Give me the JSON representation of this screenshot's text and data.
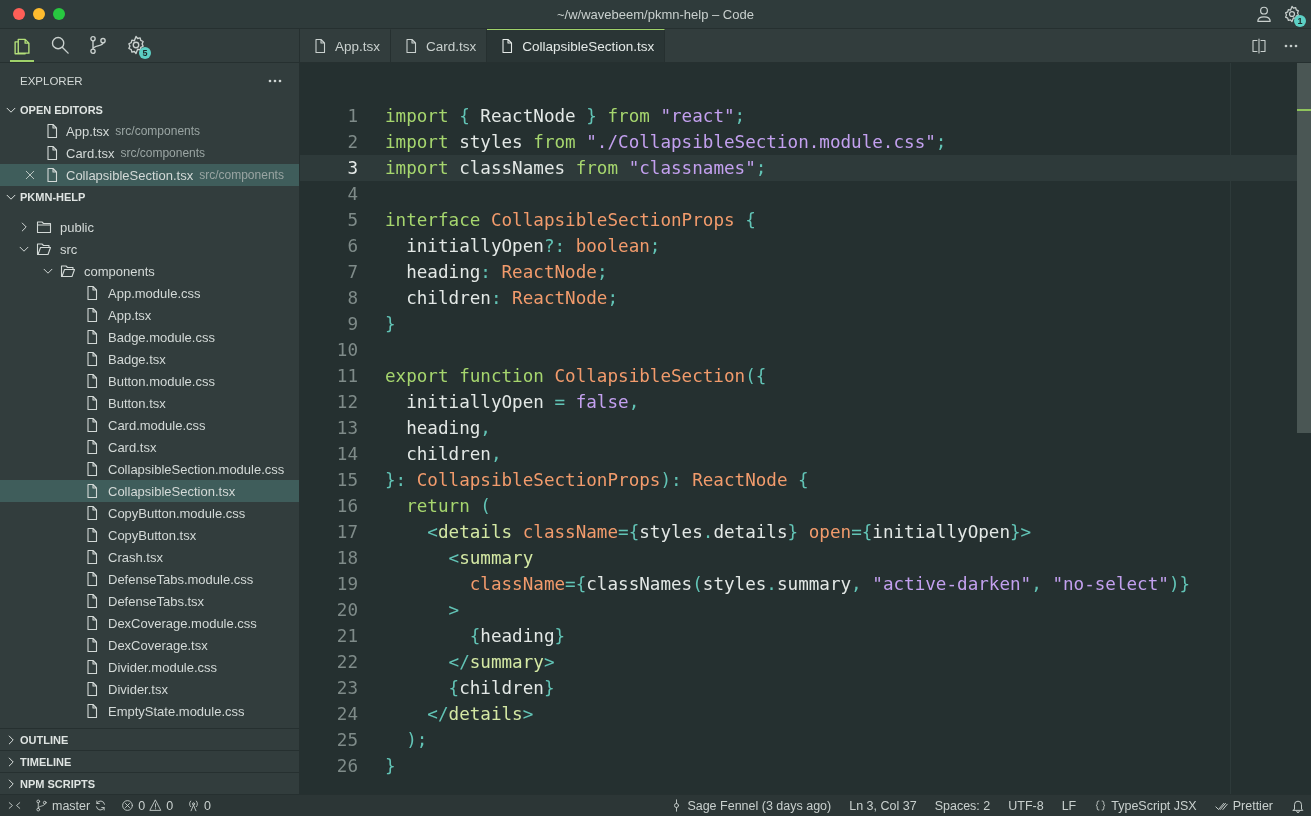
{
  "window": {
    "title": "~/w/wavebeem/pkmn-help – Code"
  },
  "activity_bar": {
    "extensions_badge": "5"
  },
  "account": {
    "settings_badge": "1"
  },
  "explorer": {
    "title": "EXPLORER",
    "open_editors": {
      "title": "OPEN EDITORS",
      "expanded": true,
      "items": [
        {
          "name": "App.tsx",
          "path": "src/components",
          "selected": false
        },
        {
          "name": "Card.tsx",
          "path": "src/components",
          "selected": false
        },
        {
          "name": "CollapsibleSection.tsx",
          "path": "src/components",
          "selected": true
        }
      ]
    },
    "project": {
      "title": "PKMN-HELP",
      "expanded": true,
      "tree": [
        {
          "kind": "folder",
          "name": "public",
          "expanded": false
        },
        {
          "kind": "folder",
          "name": "src",
          "expanded": true,
          "children": [
            {
              "kind": "folder",
              "name": "components",
              "expanded": true,
              "children": [
                {
                  "kind": "file",
                  "name": "App.module.css",
                  "selected": false
                },
                {
                  "kind": "file",
                  "name": "App.tsx",
                  "selected": false
                },
                {
                  "kind": "file",
                  "name": "Badge.module.css",
                  "selected": false
                },
                {
                  "kind": "file",
                  "name": "Badge.tsx",
                  "selected": false
                },
                {
                  "kind": "file",
                  "name": "Button.module.css",
                  "selected": false
                },
                {
                  "kind": "file",
                  "name": "Button.tsx",
                  "selected": false
                },
                {
                  "kind": "file",
                  "name": "Card.module.css",
                  "selected": false
                },
                {
                  "kind": "file",
                  "name": "Card.tsx",
                  "selected": false
                },
                {
                  "kind": "file",
                  "name": "CollapsibleSection.module.css",
                  "selected": false
                },
                {
                  "kind": "file",
                  "name": "CollapsibleSection.tsx",
                  "selected": true
                },
                {
                  "kind": "file",
                  "name": "CopyButton.module.css",
                  "selected": false
                },
                {
                  "kind": "file",
                  "name": "CopyButton.tsx",
                  "selected": false
                },
                {
                  "kind": "file",
                  "name": "Crash.tsx",
                  "selected": false
                },
                {
                  "kind": "file",
                  "name": "DefenseTabs.module.css",
                  "selected": false
                },
                {
                  "kind": "file",
                  "name": "DefenseTabs.tsx",
                  "selected": false
                },
                {
                  "kind": "file",
                  "name": "DexCoverage.module.css",
                  "selected": false
                },
                {
                  "kind": "file",
                  "name": "DexCoverage.tsx",
                  "selected": false
                },
                {
                  "kind": "file",
                  "name": "Divider.module.css",
                  "selected": false
                },
                {
                  "kind": "file",
                  "name": "Divider.tsx",
                  "selected": false
                },
                {
                  "kind": "file",
                  "name": "EmptyState.module.css",
                  "selected": false
                }
              ]
            }
          ]
        }
      ]
    },
    "sections": [
      {
        "title": "OUTLINE",
        "expanded": false
      },
      {
        "title": "TIMELINE",
        "expanded": false
      },
      {
        "title": "NPM SCRIPTS",
        "expanded": false
      }
    ]
  },
  "tabs": [
    {
      "label": "App.tsx",
      "selected": false
    },
    {
      "label": "Card.tsx",
      "selected": false
    },
    {
      "label": "CollapsibleSection.tsx",
      "selected": true
    }
  ],
  "editor": {
    "lines": [
      {
        "number": "1",
        "selected": false,
        "tokens": [
          {
            "kind": "kw",
            "text": "import"
          },
          {
            "kind": "p",
            "text": " { "
          },
          {
            "kind": "id",
            "text": "ReactNode"
          },
          {
            "kind": "p",
            "text": " } "
          },
          {
            "kind": "kw",
            "text": "from"
          },
          {
            "kind": "str",
            "text": " \"react\""
          },
          {
            "kind": "p",
            "text": ";"
          }
        ]
      },
      {
        "number": "2",
        "selected": false,
        "tokens": [
          {
            "kind": "kw",
            "text": "import"
          },
          {
            "kind": "id",
            "text": " styles "
          },
          {
            "kind": "kw",
            "text": "from"
          },
          {
            "kind": "str",
            "text": " \"./CollapsibleSection.module.css\""
          },
          {
            "kind": "p",
            "text": ";"
          }
        ]
      },
      {
        "number": "3",
        "selected": true,
        "tokens": [
          {
            "kind": "kw",
            "text": "import"
          },
          {
            "kind": "id",
            "text": " classNames "
          },
          {
            "kind": "kw",
            "text": "from"
          },
          {
            "kind": "str",
            "text": " \"classnames\""
          },
          {
            "kind": "p",
            "text": ";"
          }
        ]
      },
      {
        "number": "4",
        "selected": false
      },
      {
        "number": "5",
        "selected": false,
        "tokens": [
          {
            "kind": "kw",
            "text": "interface"
          },
          {
            "kind": "ty",
            "text": " CollapsibleSectionProps"
          },
          {
            "kind": "p",
            "text": " {"
          }
        ]
      },
      {
        "number": "6",
        "selected": false,
        "tokens": [
          {
            "kind": "id",
            "text": "  initiallyOpen"
          },
          {
            "kind": "p",
            "text": "?:"
          },
          {
            "kind": "ty",
            "text": " boolean"
          },
          {
            "kind": "p",
            "text": ";"
          }
        ]
      },
      {
        "number": "7",
        "selected": false,
        "tokens": [
          {
            "kind": "id",
            "text": "  heading"
          },
          {
            "kind": "p",
            "text": ":"
          },
          {
            "kind": "ty",
            "text": " ReactNode"
          },
          {
            "kind": "p",
            "text": ";"
          }
        ]
      },
      {
        "number": "8",
        "selected": false,
        "tokens": [
          {
            "kind": "id",
            "text": "  children"
          },
          {
            "kind": "p",
            "text": ":"
          },
          {
            "kind": "ty",
            "text": " ReactNode"
          },
          {
            "kind": "p",
            "text": ";"
          }
        ]
      },
      {
        "number": "9",
        "selected": false,
        "tokens": [
          {
            "kind": "p",
            "text": "}"
          }
        ]
      },
      {
        "number": "10",
        "selected": false
      },
      {
        "number": "11",
        "selected": false,
        "tokens": [
          {
            "kind": "kw",
            "text": "export function"
          },
          {
            "kind": "ty",
            "text": " CollapsibleSection"
          },
          {
            "kind": "p",
            "text": "({"
          }
        ]
      },
      {
        "number": "12",
        "selected": false,
        "tokens": [
          {
            "kind": "id",
            "text": "  initiallyOpen"
          },
          {
            "kind": "p",
            "text": " = "
          },
          {
            "kind": "str",
            "text": "false"
          },
          {
            "kind": "p",
            "text": ","
          }
        ]
      },
      {
        "number": "13",
        "selected": false,
        "tokens": [
          {
            "kind": "id",
            "text": "  heading"
          },
          {
            "kind": "p",
            "text": ","
          }
        ]
      },
      {
        "number": "14",
        "selected": false,
        "tokens": [
          {
            "kind": "id",
            "text": "  children"
          },
          {
            "kind": "p",
            "text": ","
          }
        ]
      },
      {
        "number": "15",
        "selected": false,
        "tokens": [
          {
            "kind": "p",
            "text": "}: "
          },
          {
            "kind": "ty",
            "text": "CollapsibleSectionProps"
          },
          {
            "kind": "p",
            "text": "): "
          },
          {
            "kind": "ty",
            "text": "ReactNode"
          },
          {
            "kind": "p",
            "text": " {"
          }
        ]
      },
      {
        "number": "16",
        "selected": false,
        "tokens": [
          {
            "kind": "kw",
            "text": "  return"
          },
          {
            "kind": "p",
            "text": " ("
          }
        ]
      },
      {
        "number": "17",
        "selected": false,
        "tokens": [
          {
            "kind": "p",
            "text": "    <"
          },
          {
            "kind": "tag",
            "text": "details"
          },
          {
            "kind": "ty",
            "text": " className"
          },
          {
            "kind": "p",
            "text": "={"
          },
          {
            "kind": "id",
            "text": "styles"
          },
          {
            "kind": "p",
            "text": "."
          },
          {
            "kind": "id",
            "text": "details"
          },
          {
            "kind": "p",
            "text": "}"
          },
          {
            "kind": "ty",
            "text": " open"
          },
          {
            "kind": "p",
            "text": "={"
          },
          {
            "kind": "id",
            "text": "initiallyOpen"
          },
          {
            "kind": "p",
            "text": "}>"
          }
        ]
      },
      {
        "number": "18",
        "selected": false,
        "tokens": [
          {
            "kind": "p",
            "text": "      <"
          },
          {
            "kind": "tag",
            "text": "summary"
          }
        ]
      },
      {
        "number": "19",
        "selected": false,
        "tokens": [
          {
            "kind": "ty",
            "text": "        className"
          },
          {
            "kind": "p",
            "text": "={"
          },
          {
            "kind": "id",
            "text": "classNames"
          },
          {
            "kind": "p",
            "text": "("
          },
          {
            "kind": "id",
            "text": "styles"
          },
          {
            "kind": "p",
            "text": "."
          },
          {
            "kind": "id",
            "text": "summary"
          },
          {
            "kind": "p",
            "text": ", "
          },
          {
            "kind": "str",
            "text": "\"active-darken\""
          },
          {
            "kind": "p",
            "text": ", "
          },
          {
            "kind": "str",
            "text": "\"no-select\""
          },
          {
            "kind": "p",
            "text": ")}"
          }
        ]
      },
      {
        "number": "20",
        "selected": false,
        "tokens": [
          {
            "kind": "p",
            "text": "      >"
          }
        ]
      },
      {
        "number": "21",
        "selected": false,
        "tokens": [
          {
            "kind": "p",
            "text": "        {"
          },
          {
            "kind": "id",
            "text": "heading"
          },
          {
            "kind": "p",
            "text": "}"
          }
        ]
      },
      {
        "number": "22",
        "selected": false,
        "tokens": [
          {
            "kind": "p",
            "text": "      </"
          },
          {
            "kind": "tag",
            "text": "summary"
          },
          {
            "kind": "p",
            "text": ">"
          }
        ]
      },
      {
        "number": "23",
        "selected": false,
        "tokens": [
          {
            "kind": "p",
            "text": "      {"
          },
          {
            "kind": "id",
            "text": "children"
          },
          {
            "kind": "p",
            "text": "}"
          }
        ]
      },
      {
        "number": "24",
        "selected": false,
        "tokens": [
          {
            "kind": "p",
            "text": "    </"
          },
          {
            "kind": "tag",
            "text": "details"
          },
          {
            "kind": "p",
            "text": ">"
          }
        ]
      },
      {
        "number": "25",
        "selected": false,
        "tokens": [
          {
            "kind": "p",
            "text": "  );"
          }
        ]
      },
      {
        "number": "26",
        "selected": false,
        "tokens": [
          {
            "kind": "p",
            "text": "}"
          }
        ]
      }
    ]
  },
  "status_bar": {
    "branch": "master",
    "errors": "0",
    "warnings": "0",
    "ports": "0",
    "right": [
      {
        "kind": "blame",
        "text": "Sage Fennel (3 days ago)"
      },
      {
        "kind": "plain",
        "text": "Ln 3, Col 37"
      },
      {
        "kind": "plain",
        "text": "Spaces: 2"
      },
      {
        "kind": "plain",
        "text": "UTF-8"
      },
      {
        "kind": "plain",
        "text": "LF"
      },
      {
        "kind": "language",
        "text": "TypeScript JSX"
      },
      {
        "kind": "formatter",
        "text": "Prettier"
      }
    ]
  }
}
